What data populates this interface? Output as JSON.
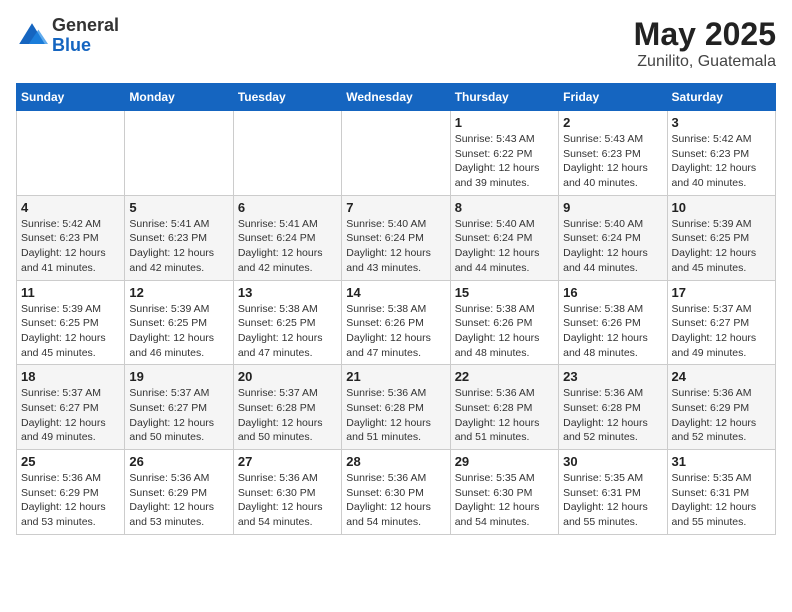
{
  "header": {
    "logo_general": "General",
    "logo_blue": "Blue",
    "title": "May 2025",
    "subtitle": "Zunilito, Guatemala"
  },
  "days_of_week": [
    "Sunday",
    "Monday",
    "Tuesday",
    "Wednesday",
    "Thursday",
    "Friday",
    "Saturday"
  ],
  "weeks": [
    [
      {
        "day": "",
        "info": ""
      },
      {
        "day": "",
        "info": ""
      },
      {
        "day": "",
        "info": ""
      },
      {
        "day": "",
        "info": ""
      },
      {
        "day": "1",
        "info": "Sunrise: 5:43 AM\nSunset: 6:22 PM\nDaylight: 12 hours and 39 minutes."
      },
      {
        "day": "2",
        "info": "Sunrise: 5:43 AM\nSunset: 6:23 PM\nDaylight: 12 hours and 40 minutes."
      },
      {
        "day": "3",
        "info": "Sunrise: 5:42 AM\nSunset: 6:23 PM\nDaylight: 12 hours and 40 minutes."
      }
    ],
    [
      {
        "day": "4",
        "info": "Sunrise: 5:42 AM\nSunset: 6:23 PM\nDaylight: 12 hours and 41 minutes."
      },
      {
        "day": "5",
        "info": "Sunrise: 5:41 AM\nSunset: 6:23 PM\nDaylight: 12 hours and 42 minutes."
      },
      {
        "day": "6",
        "info": "Sunrise: 5:41 AM\nSunset: 6:24 PM\nDaylight: 12 hours and 42 minutes."
      },
      {
        "day": "7",
        "info": "Sunrise: 5:40 AM\nSunset: 6:24 PM\nDaylight: 12 hours and 43 minutes."
      },
      {
        "day": "8",
        "info": "Sunrise: 5:40 AM\nSunset: 6:24 PM\nDaylight: 12 hours and 44 minutes."
      },
      {
        "day": "9",
        "info": "Sunrise: 5:40 AM\nSunset: 6:24 PM\nDaylight: 12 hours and 44 minutes."
      },
      {
        "day": "10",
        "info": "Sunrise: 5:39 AM\nSunset: 6:25 PM\nDaylight: 12 hours and 45 minutes."
      }
    ],
    [
      {
        "day": "11",
        "info": "Sunrise: 5:39 AM\nSunset: 6:25 PM\nDaylight: 12 hours and 45 minutes."
      },
      {
        "day": "12",
        "info": "Sunrise: 5:39 AM\nSunset: 6:25 PM\nDaylight: 12 hours and 46 minutes."
      },
      {
        "day": "13",
        "info": "Sunrise: 5:38 AM\nSunset: 6:25 PM\nDaylight: 12 hours and 47 minutes."
      },
      {
        "day": "14",
        "info": "Sunrise: 5:38 AM\nSunset: 6:26 PM\nDaylight: 12 hours and 47 minutes."
      },
      {
        "day": "15",
        "info": "Sunrise: 5:38 AM\nSunset: 6:26 PM\nDaylight: 12 hours and 48 minutes."
      },
      {
        "day": "16",
        "info": "Sunrise: 5:38 AM\nSunset: 6:26 PM\nDaylight: 12 hours and 48 minutes."
      },
      {
        "day": "17",
        "info": "Sunrise: 5:37 AM\nSunset: 6:27 PM\nDaylight: 12 hours and 49 minutes."
      }
    ],
    [
      {
        "day": "18",
        "info": "Sunrise: 5:37 AM\nSunset: 6:27 PM\nDaylight: 12 hours and 49 minutes."
      },
      {
        "day": "19",
        "info": "Sunrise: 5:37 AM\nSunset: 6:27 PM\nDaylight: 12 hours and 50 minutes."
      },
      {
        "day": "20",
        "info": "Sunrise: 5:37 AM\nSunset: 6:28 PM\nDaylight: 12 hours and 50 minutes."
      },
      {
        "day": "21",
        "info": "Sunrise: 5:36 AM\nSunset: 6:28 PM\nDaylight: 12 hours and 51 minutes."
      },
      {
        "day": "22",
        "info": "Sunrise: 5:36 AM\nSunset: 6:28 PM\nDaylight: 12 hours and 51 minutes."
      },
      {
        "day": "23",
        "info": "Sunrise: 5:36 AM\nSunset: 6:28 PM\nDaylight: 12 hours and 52 minutes."
      },
      {
        "day": "24",
        "info": "Sunrise: 5:36 AM\nSunset: 6:29 PM\nDaylight: 12 hours and 52 minutes."
      }
    ],
    [
      {
        "day": "25",
        "info": "Sunrise: 5:36 AM\nSunset: 6:29 PM\nDaylight: 12 hours and 53 minutes."
      },
      {
        "day": "26",
        "info": "Sunrise: 5:36 AM\nSunset: 6:29 PM\nDaylight: 12 hours and 53 minutes."
      },
      {
        "day": "27",
        "info": "Sunrise: 5:36 AM\nSunset: 6:30 PM\nDaylight: 12 hours and 54 minutes."
      },
      {
        "day": "28",
        "info": "Sunrise: 5:36 AM\nSunset: 6:30 PM\nDaylight: 12 hours and 54 minutes."
      },
      {
        "day": "29",
        "info": "Sunrise: 5:35 AM\nSunset: 6:30 PM\nDaylight: 12 hours and 54 minutes."
      },
      {
        "day": "30",
        "info": "Sunrise: 5:35 AM\nSunset: 6:31 PM\nDaylight: 12 hours and 55 minutes."
      },
      {
        "day": "31",
        "info": "Sunrise: 5:35 AM\nSunset: 6:31 PM\nDaylight: 12 hours and 55 minutes."
      }
    ]
  ]
}
